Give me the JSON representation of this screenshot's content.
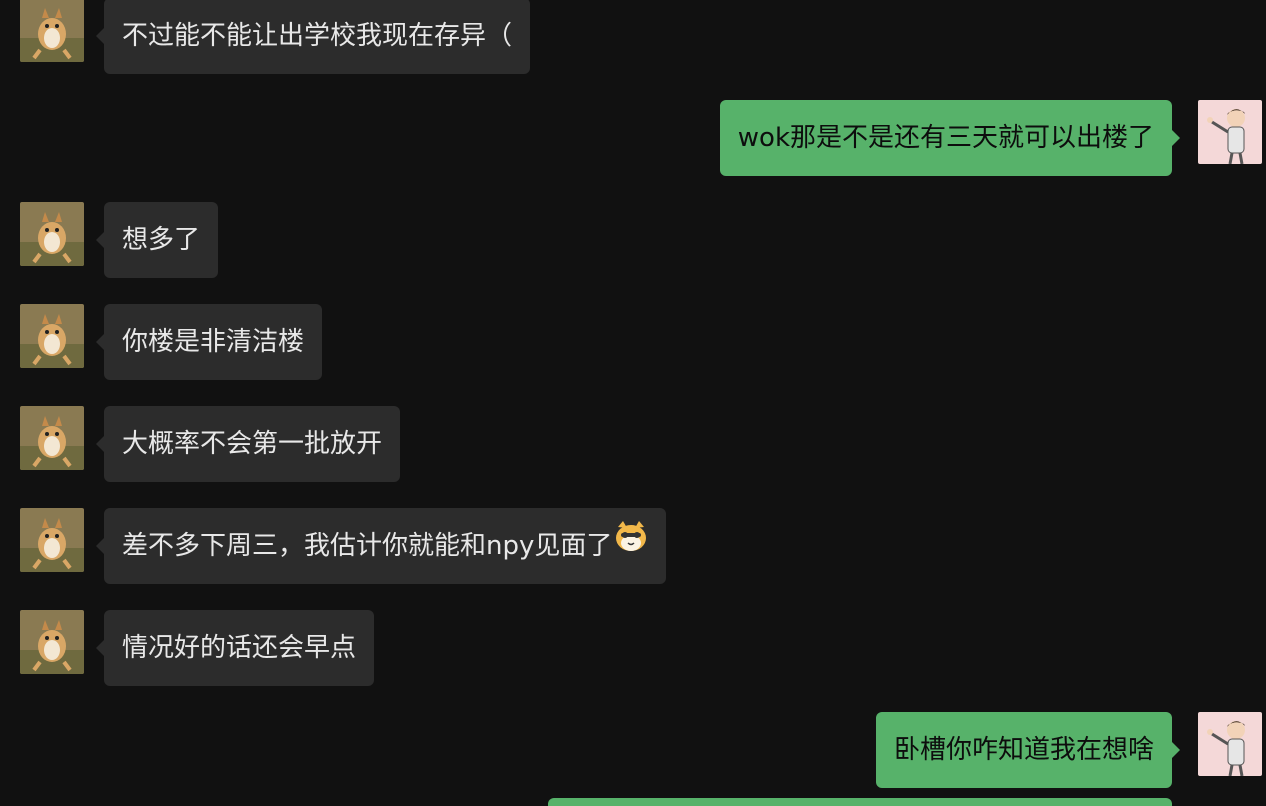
{
  "messages": [
    {
      "side": "left",
      "text": "不过能不能让出学校我现在存异（"
    },
    {
      "side": "right",
      "text": "wok那是不是还有三天就可以出楼了"
    },
    {
      "side": "left",
      "text": "想多了"
    },
    {
      "side": "left",
      "text": "你楼是非清洁楼"
    },
    {
      "side": "left",
      "text": "大概率不会第一批放开"
    },
    {
      "side": "left",
      "text": "差不多下周三，我估计你就能和npy见面了",
      "emoji": "cat-face-emoji"
    },
    {
      "side": "left",
      "text": "情况好的话还会早点"
    },
    {
      "side": "right",
      "text": "卧槽你咋知道我在想啥"
    }
  ],
  "colors": {
    "background": "#111111",
    "incoming_bubble": "#2c2c2c",
    "outgoing_bubble": "#57b26a"
  },
  "icons": {
    "contact_avatar": "dog-avatar",
    "self_avatar": "cartoon-man-avatar"
  }
}
